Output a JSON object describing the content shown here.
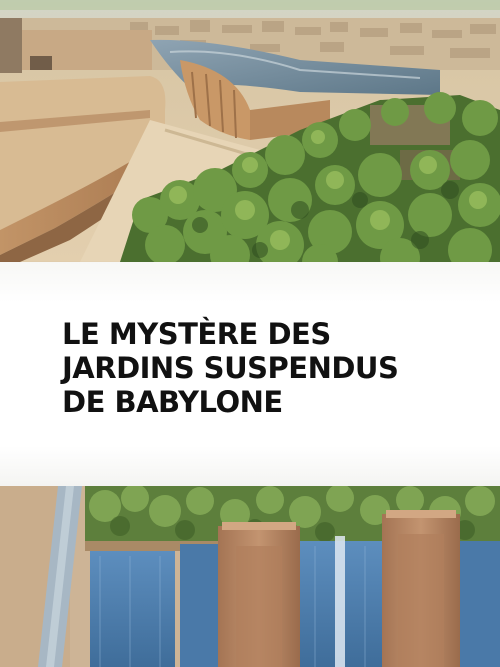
{
  "title": {
    "lines": [
      "LE MYSTÈRE DES",
      "JARDINS SUSPENDUS",
      "DE BABYLONE"
    ]
  },
  "images": {
    "top": "aerial-view-babylon-walls-and-hanging-gardens",
    "bottom": "terraced-gardens-with-water-channels"
  },
  "colors": {
    "sand": "#d9c2a0",
    "brick": "#b98a62",
    "foliage": "#4f7a34",
    "water": "#4f7fae",
    "text": "#111111"
  }
}
